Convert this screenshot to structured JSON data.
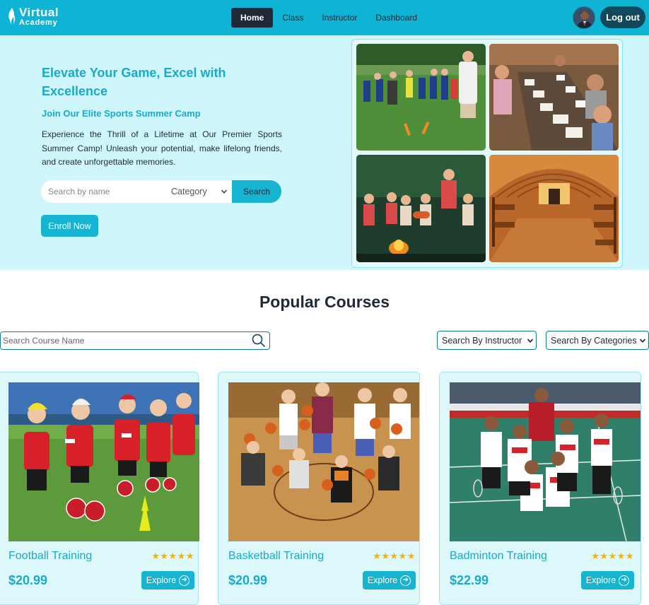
{
  "brand": {
    "line1": "Virtual",
    "line2": "Academy"
  },
  "nav": {
    "items": [
      {
        "label": "Home",
        "active": true
      },
      {
        "label": "Class",
        "active": false
      },
      {
        "label": "Instructor",
        "active": false
      },
      {
        "label": "Dashboard",
        "active": false
      }
    ]
  },
  "auth": {
    "logout_label": "Log out"
  },
  "hero": {
    "title": "Elevate Your Game, Excel with Excellence",
    "subtitle": "Join Our Elite Sports Summer Camp",
    "description": "Experience the Thrill of a Lifetime at Our Premier Sports Summer Camp! Unleash your potential, make lifelong friends, and create unforgettable memories.",
    "search_placeholder": "Search by name",
    "category_selected": "Category",
    "search_button": "Search",
    "enroll_button": "Enroll Now"
  },
  "courses": {
    "title": "Popular Courses",
    "search_placeholder": "Search Course Name",
    "instructor_filter": "Search By Instructor",
    "category_filter": "Search By Categories",
    "items": [
      {
        "title": "Football Training",
        "price": "$20.99",
        "stars": "★★★★★",
        "button": "Explore"
      },
      {
        "title": "Basketball Training",
        "price": "$20.99",
        "stars": "★★★★★",
        "button": "Explore"
      },
      {
        "title": "Badminton Training",
        "price": "$22.99",
        "stars": "★★★★★",
        "button": "Explore"
      }
    ]
  },
  "colors": {
    "navbar": "#0fb3d3",
    "hero_bg": "#cff6fb",
    "accent_text": "#1aaac9",
    "dark": "#1f2937",
    "logout_bg": "#12485c"
  },
  "icons": [
    "flame-logo-icon",
    "user-avatar",
    "search-icon",
    "chevron-down-icon",
    "star-icon",
    "arrow-circle-right-icon"
  ]
}
